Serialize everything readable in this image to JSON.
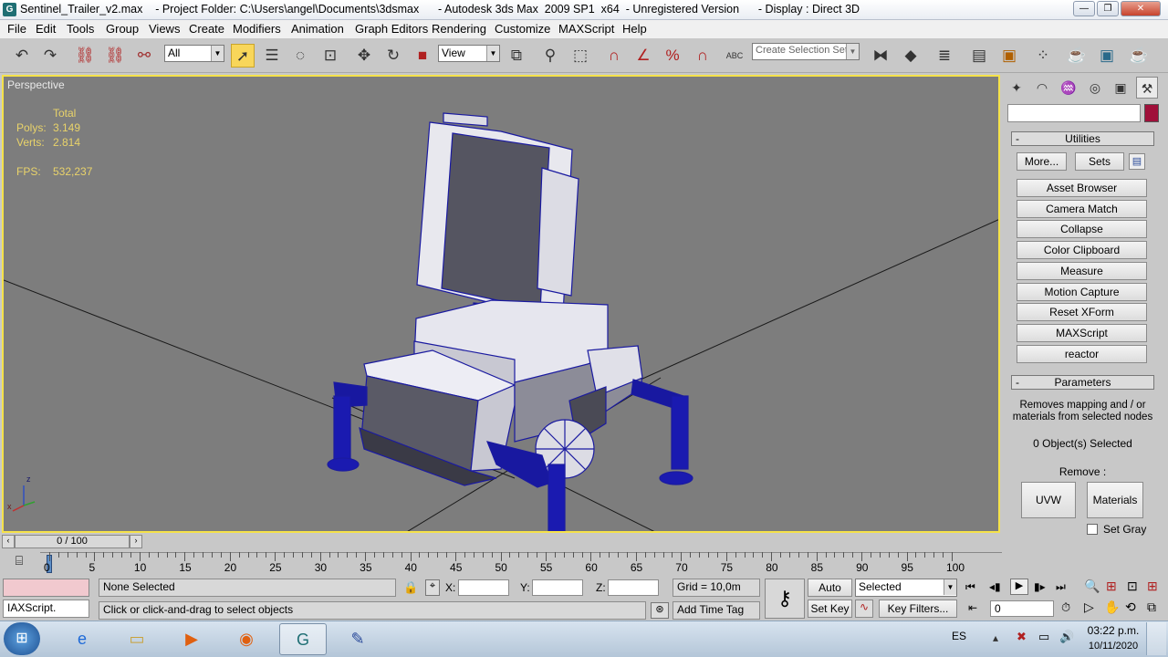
{
  "window": {
    "title": "Sentinel_Trailer_v2.max    - Project Folder: C:\\Users\\angel\\Documents\\3dsmax      - Autodesk 3ds Max  2009 SP1  x64  - Unregistered Version      - Display : Direct 3D",
    "minimize": "—",
    "maximize": "❐",
    "close": "✕"
  },
  "menu": [
    "File",
    "Edit",
    "Tools",
    "Group",
    "Views",
    "Create",
    "Modifiers",
    "Animation",
    "Graph Editors",
    "Rendering",
    "Customize",
    "MAXScript",
    "Help"
  ],
  "toolbar": {
    "filter_value": "All",
    "refcoord_value": "View",
    "selection_set_placeholder": "Create Selection Set",
    "abc_label": "ABC"
  },
  "viewport": {
    "label": "Perspective",
    "stats_total": "Total",
    "polys_label": "Polys:",
    "polys_value": "3.149",
    "verts_label": "Verts:",
    "verts_value": "2.814",
    "fps_label": "FPS:",
    "fps_value": "532,237",
    "axis_z": "z",
    "axis_x": "x"
  },
  "command_panel": {
    "name_field": "",
    "color_swatch": "#a0103a",
    "utilities_header": "Utilities",
    "more_button": "More...",
    "sets_button": "Sets",
    "utility_buttons": [
      "Asset Browser",
      "Camera Match",
      "Collapse",
      "Color Clipboard",
      "Measure",
      "Motion Capture",
      "Reset XForm",
      "MAXScript",
      "reactor"
    ],
    "parameters_header": "Parameters",
    "description": "Removes mapping and / or materials from selected nodes",
    "selected_count": "0 Object(s) Selected",
    "remove_label": "Remove :",
    "uvw_button": "UVW",
    "materials_button": "Materials",
    "set_gray_label": "Set Gray"
  },
  "timeline": {
    "frame_counter": "0 / 100",
    "ticks": [
      "0",
      "5",
      "10",
      "15",
      "20",
      "25",
      "30",
      "35",
      "40",
      "45",
      "50",
      "55",
      "60",
      "65",
      "70",
      "75",
      "80",
      "85",
      "90",
      "95",
      "100"
    ]
  },
  "status": {
    "maxscript_listener": "IAXScript.",
    "selection_status": "None Selected",
    "prompt": "Click or click-and-drag to select objects",
    "x_label": "X:",
    "y_label": "Y:",
    "z_label": "Z:",
    "x_value": "",
    "y_value": "",
    "z_value": "",
    "grid": "Grid = 10,0m",
    "add_time_tag": "Add Time Tag",
    "auto_key": "Auto Key",
    "set_key": "Set Key",
    "key_mode_select": "Selected",
    "key_filters": "Key Filters...",
    "current_frame": "0"
  },
  "taskbar": {
    "language": "ES",
    "time": "03:22 p.m.",
    "date": "10/11/2020"
  }
}
